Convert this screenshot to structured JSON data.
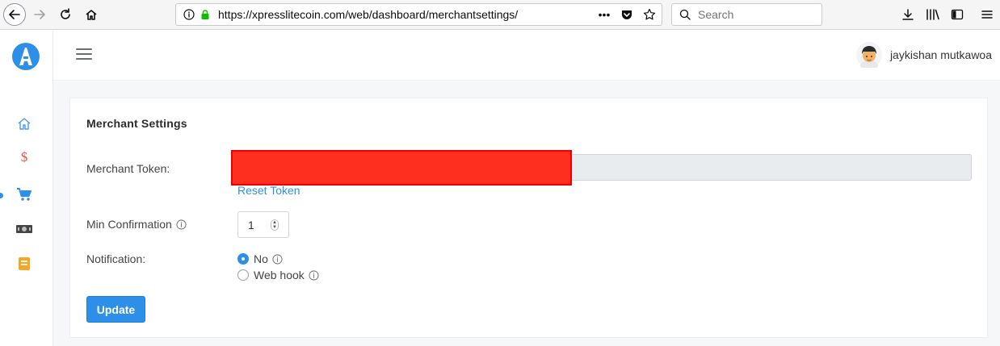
{
  "browser": {
    "url_scheme": "https://",
    "url_domain": "xpresslitecoin.com",
    "url_path": "/web/dashboard/merchantsettings/",
    "search_placeholder": "Search",
    "page_actions_label": "•••"
  },
  "header": {
    "user_name": "jaykishan mutkawoa"
  },
  "sidebar": {
    "items": [
      {
        "icon": "home-icon",
        "color": "#4a9be8"
      },
      {
        "icon": "dollar-icon",
        "color": "#e0534a",
        "label": "$"
      },
      {
        "icon": "cart-icon",
        "color": "#2e8fe8",
        "active": true
      },
      {
        "icon": "cash-icon",
        "color": "#444444"
      },
      {
        "icon": "book-icon",
        "color": "#f5a623"
      }
    ]
  },
  "merchant_settings": {
    "title": "Merchant Settings",
    "token_label": "Merchant Token:",
    "reset_token_label": "Reset Token",
    "min_confirmation_label": "Min Confirmation",
    "min_confirmation_value": "1",
    "notification_label": "Notification:",
    "notification_options": [
      {
        "label": "No",
        "checked": true
      },
      {
        "label": "Web hook",
        "checked": false
      }
    ],
    "update_label": "Update"
  },
  "colors": {
    "accent": "#2e8fe8",
    "redaction": "#ff2f1f"
  }
}
